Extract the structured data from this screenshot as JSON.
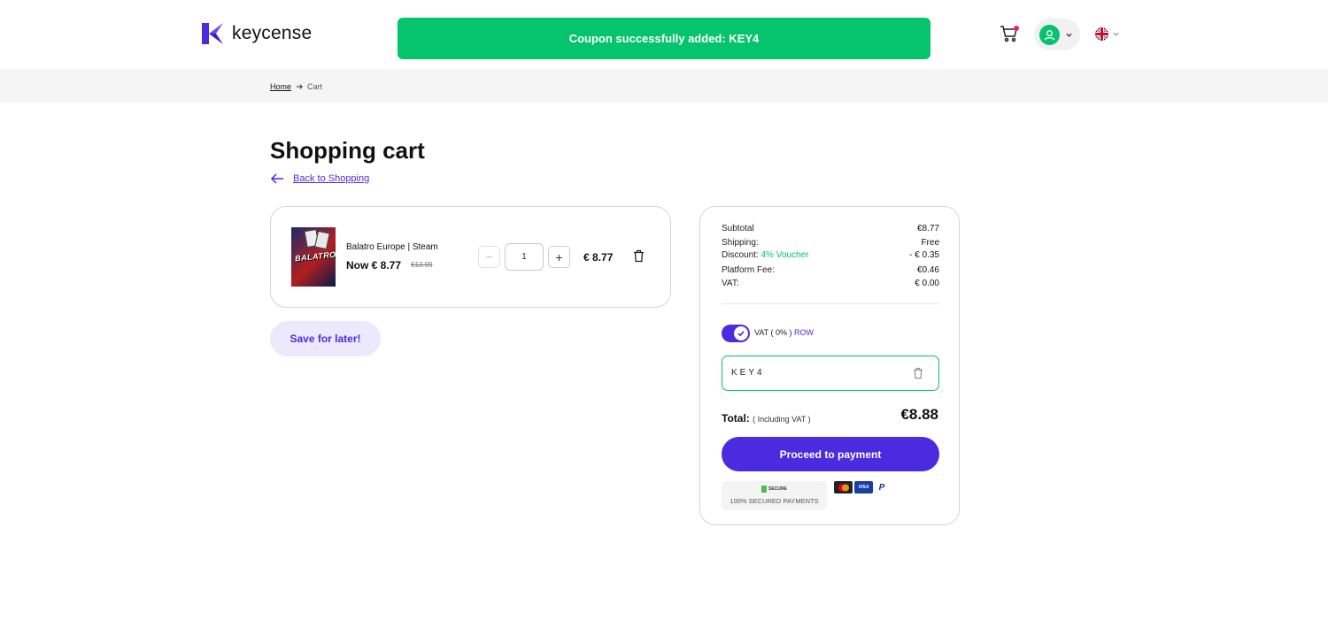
{
  "brand": {
    "name": "keycense"
  },
  "toast": {
    "message": "Coupon successfully added: KEY4"
  },
  "breadcrumb": {
    "home": "Home",
    "current": "Cart"
  },
  "page": {
    "title": "Shopping cart",
    "back_link": "Back to Shopping"
  },
  "cart_item": {
    "name": "Balatro Europe | Steam",
    "thumb_text": "BALATRO",
    "price_now": "Now € 8.77",
    "price_old": "€13.99",
    "quantity": "1",
    "minus": "−",
    "plus": "+",
    "line_total": "€ 8.77"
  },
  "save_later": "Save for later!",
  "summary": {
    "subtotal_label": "Subtotal",
    "subtotal_value": "€8.77",
    "shipping_label": "Shipping:",
    "shipping_value": "Free",
    "discount_label": "Discount:",
    "discount_tag": "4% Voucher",
    "discount_value": "- € 0.35",
    "platform_fee_label": "Platform Fee:",
    "platform_fee_value": "€0.46",
    "vat_label": "VAT:",
    "vat_value": "€ 0.00",
    "vat_toggle_label": "VAT ( 0% )",
    "vat_region": "ROW",
    "coupon_code": "KEY4",
    "total_label": "Total:",
    "total_note": "( Including VAT )",
    "total_value": "€8.88",
    "pay_button": "Proceed to payment",
    "secure_badge": "SECURE",
    "secure_text": "100% SECURED PAYMENTS"
  },
  "payment_icons": [
    "mastercard-icon",
    "visa-icon",
    "paypal-icon"
  ],
  "card_labels": {
    "visa": "VISA",
    "paypal": "P"
  },
  "colors": {
    "accent": "#4b2be0",
    "success": "#05c46b",
    "notify": "#e5246b"
  }
}
